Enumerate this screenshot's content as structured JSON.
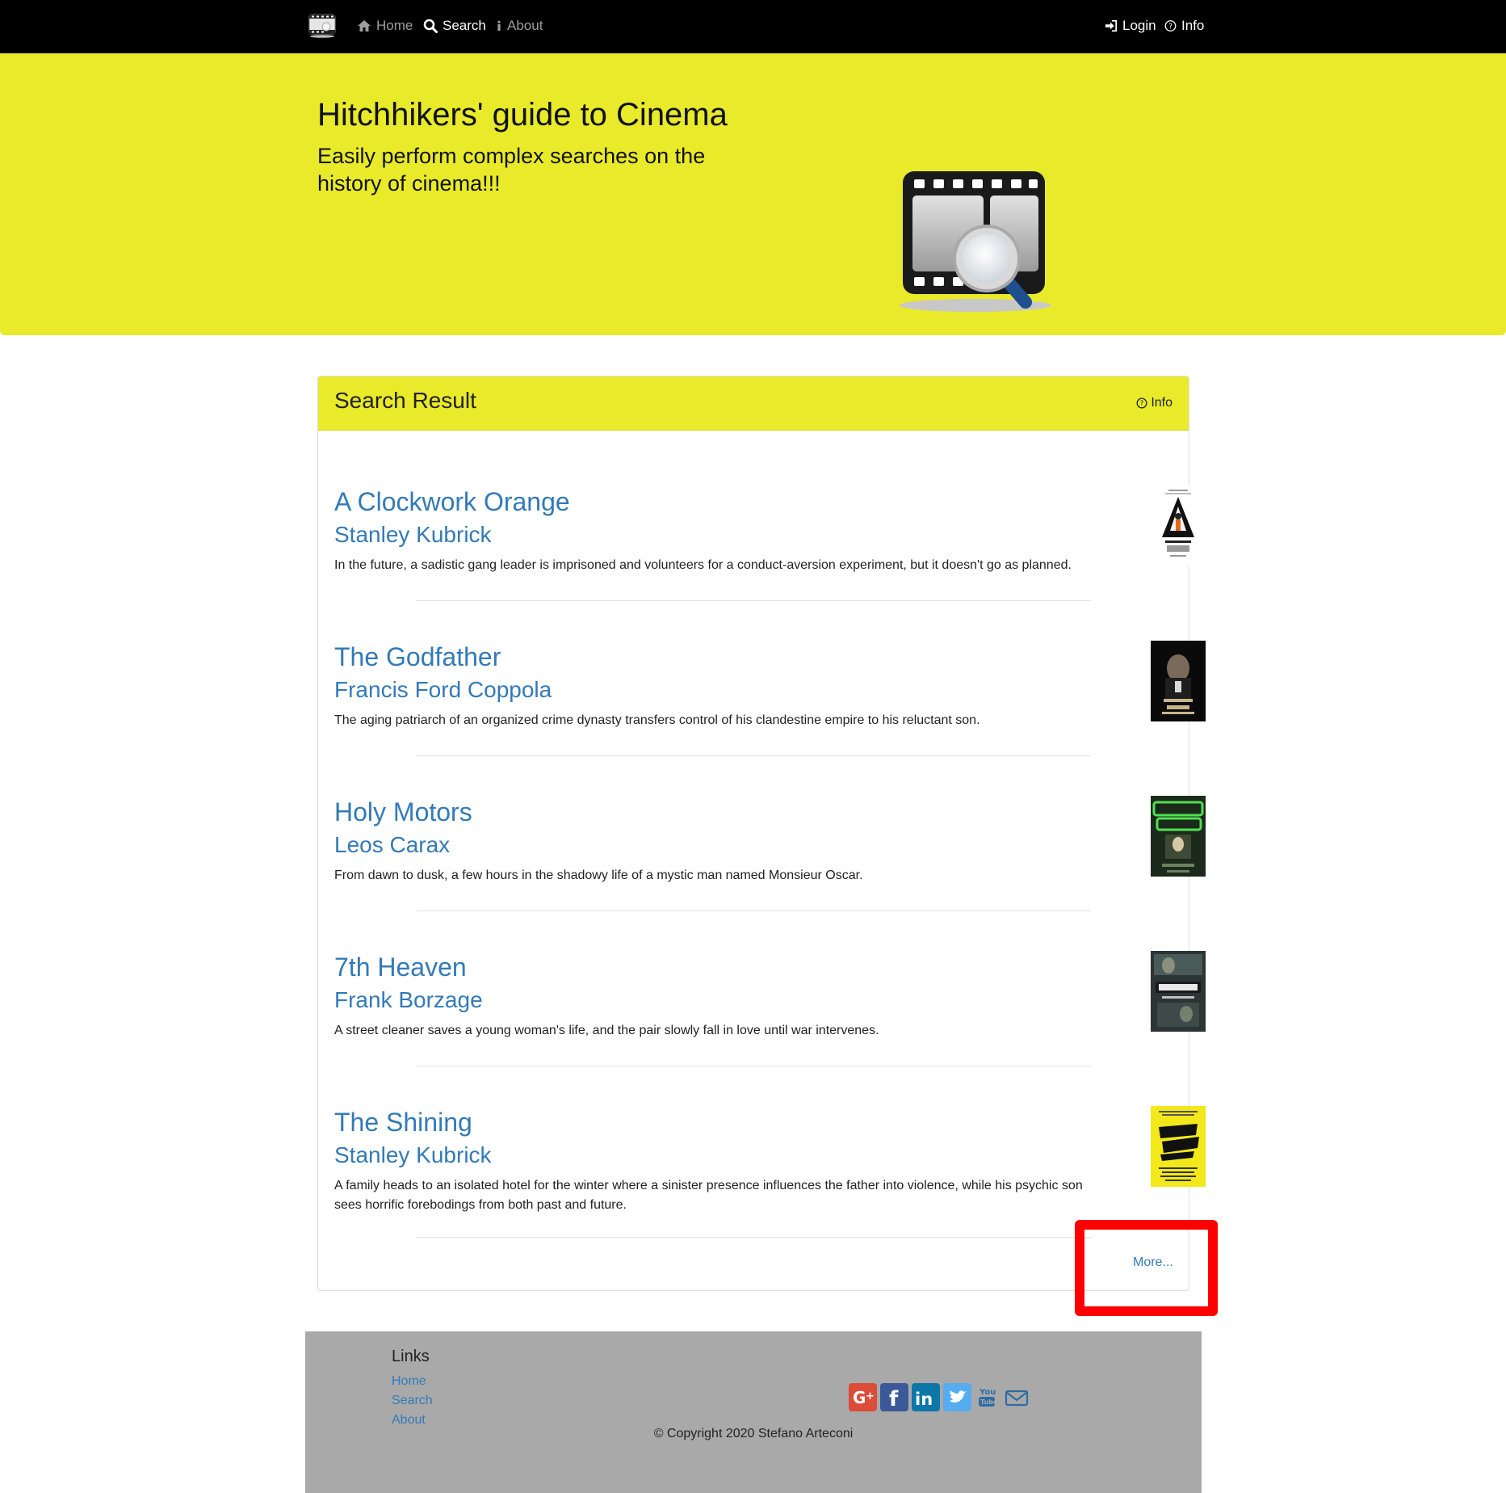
{
  "nav": {
    "home": "Home",
    "search": "Search",
    "about": "About",
    "login": "Login",
    "info": "Info"
  },
  "jumbotron": {
    "title": "Hitchhikers' guide to Cinema",
    "subtitle": "Easily perform complex searches on the history of cinema!!!"
  },
  "panel": {
    "title": "Search Result",
    "info": "Info",
    "more": "More..."
  },
  "results": [
    {
      "title": "A Clockwork Orange",
      "director": "Stanley Kubrick",
      "description": "In the future, a sadistic gang leader is imprisoned and volunteers for a conduct-aversion experiment, but it doesn't go as planned."
    },
    {
      "title": "The Godfather",
      "director": "Francis Ford Coppola",
      "description": "The aging patriarch of an organized crime dynasty transfers control of his clandestine empire to his reluctant son."
    },
    {
      "title": "Holy Motors",
      "director": "Leos Carax",
      "description": "From dawn to dusk, a few hours in the shadowy life of a mystic man named Monsieur Oscar."
    },
    {
      "title": "7th Heaven",
      "director": "Frank Borzage",
      "description": "A street cleaner saves a young woman's life, and the pair slowly fall in love until war intervenes."
    },
    {
      "title": "The Shining",
      "director": "Stanley Kubrick",
      "description": "A family heads to an isolated hotel for the winter where a sinister presence influences the father into violence, while his psychic son sees horrific forebodings from both past and future."
    }
  ],
  "footer": {
    "links_title": "Links",
    "links": [
      "Home",
      "Search",
      "About"
    ],
    "social_icons": [
      "google-plus-icon",
      "facebook-icon",
      "linkedin-icon",
      "twitter-icon",
      "youtube-icon",
      "mail-icon"
    ],
    "copyright": "© Copyright 2020 Stefano Arteconi"
  },
  "colors": {
    "navbar": "#000000",
    "accent_yellow": "#e8ea2a",
    "link_blue": "#337ab7",
    "footer_gray": "#a9a9a9",
    "highlight_red": "#ff0000"
  }
}
